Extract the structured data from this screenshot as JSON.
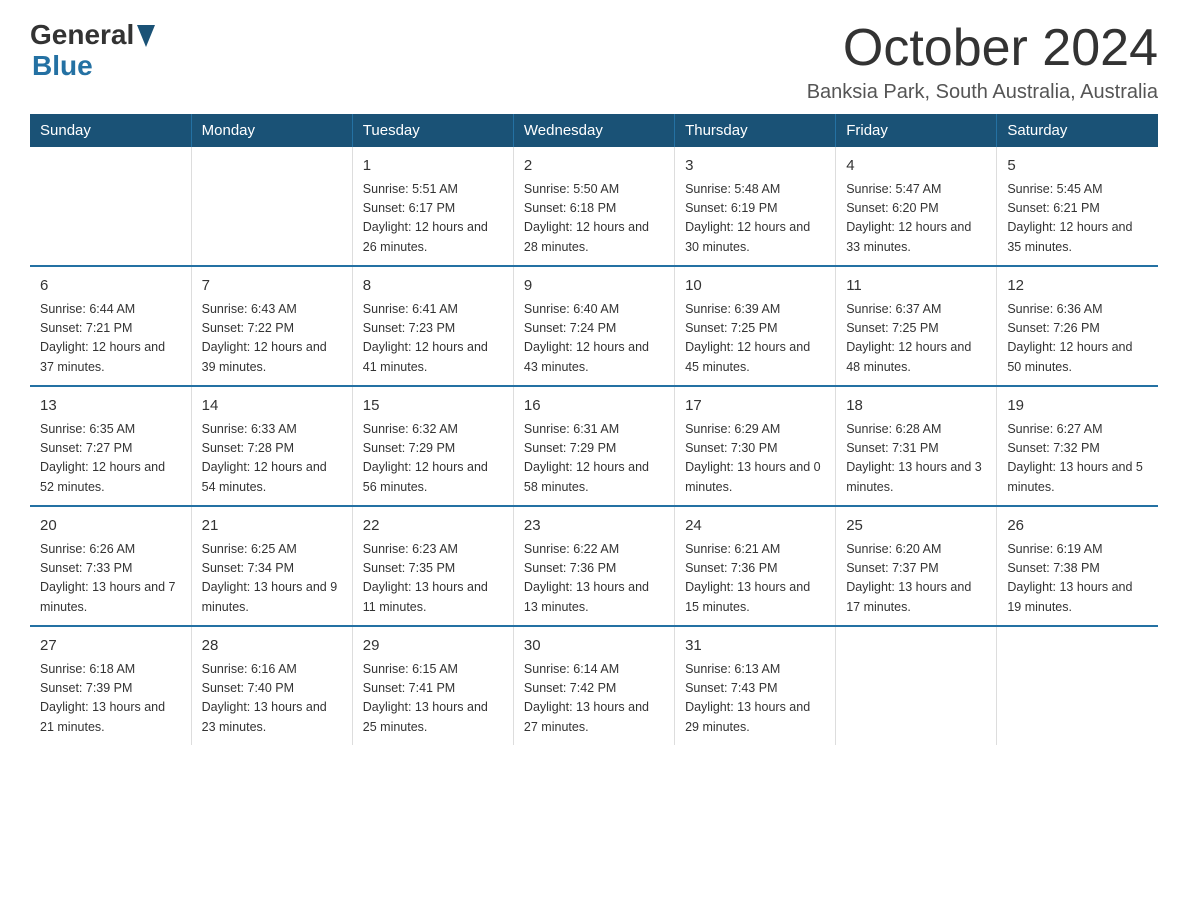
{
  "logo": {
    "text_general": "General",
    "text_blue": "Blue"
  },
  "header": {
    "month_year": "October 2024",
    "location": "Banksia Park, South Australia, Australia"
  },
  "weekdays": [
    "Sunday",
    "Monday",
    "Tuesday",
    "Wednesday",
    "Thursday",
    "Friday",
    "Saturday"
  ],
  "weeks": [
    [
      {
        "day": "",
        "sunrise": "",
        "sunset": "",
        "daylight": ""
      },
      {
        "day": "",
        "sunrise": "",
        "sunset": "",
        "daylight": ""
      },
      {
        "day": "1",
        "sunrise": "Sunrise: 5:51 AM",
        "sunset": "Sunset: 6:17 PM",
        "daylight": "Daylight: 12 hours and 26 minutes."
      },
      {
        "day": "2",
        "sunrise": "Sunrise: 5:50 AM",
        "sunset": "Sunset: 6:18 PM",
        "daylight": "Daylight: 12 hours and 28 minutes."
      },
      {
        "day": "3",
        "sunrise": "Sunrise: 5:48 AM",
        "sunset": "Sunset: 6:19 PM",
        "daylight": "Daylight: 12 hours and 30 minutes."
      },
      {
        "day": "4",
        "sunrise": "Sunrise: 5:47 AM",
        "sunset": "Sunset: 6:20 PM",
        "daylight": "Daylight: 12 hours and 33 minutes."
      },
      {
        "day": "5",
        "sunrise": "Sunrise: 5:45 AM",
        "sunset": "Sunset: 6:21 PM",
        "daylight": "Daylight: 12 hours and 35 minutes."
      }
    ],
    [
      {
        "day": "6",
        "sunrise": "Sunrise: 6:44 AM",
        "sunset": "Sunset: 7:21 PM",
        "daylight": "Daylight: 12 hours and 37 minutes."
      },
      {
        "day": "7",
        "sunrise": "Sunrise: 6:43 AM",
        "sunset": "Sunset: 7:22 PM",
        "daylight": "Daylight: 12 hours and 39 minutes."
      },
      {
        "day": "8",
        "sunrise": "Sunrise: 6:41 AM",
        "sunset": "Sunset: 7:23 PM",
        "daylight": "Daylight: 12 hours and 41 minutes."
      },
      {
        "day": "9",
        "sunrise": "Sunrise: 6:40 AM",
        "sunset": "Sunset: 7:24 PM",
        "daylight": "Daylight: 12 hours and 43 minutes."
      },
      {
        "day": "10",
        "sunrise": "Sunrise: 6:39 AM",
        "sunset": "Sunset: 7:25 PM",
        "daylight": "Daylight: 12 hours and 45 minutes."
      },
      {
        "day": "11",
        "sunrise": "Sunrise: 6:37 AM",
        "sunset": "Sunset: 7:25 PM",
        "daylight": "Daylight: 12 hours and 48 minutes."
      },
      {
        "day": "12",
        "sunrise": "Sunrise: 6:36 AM",
        "sunset": "Sunset: 7:26 PM",
        "daylight": "Daylight: 12 hours and 50 minutes."
      }
    ],
    [
      {
        "day": "13",
        "sunrise": "Sunrise: 6:35 AM",
        "sunset": "Sunset: 7:27 PM",
        "daylight": "Daylight: 12 hours and 52 minutes."
      },
      {
        "day": "14",
        "sunrise": "Sunrise: 6:33 AM",
        "sunset": "Sunset: 7:28 PM",
        "daylight": "Daylight: 12 hours and 54 minutes."
      },
      {
        "day": "15",
        "sunrise": "Sunrise: 6:32 AM",
        "sunset": "Sunset: 7:29 PM",
        "daylight": "Daylight: 12 hours and 56 minutes."
      },
      {
        "day": "16",
        "sunrise": "Sunrise: 6:31 AM",
        "sunset": "Sunset: 7:29 PM",
        "daylight": "Daylight: 12 hours and 58 minutes."
      },
      {
        "day": "17",
        "sunrise": "Sunrise: 6:29 AM",
        "sunset": "Sunset: 7:30 PM",
        "daylight": "Daylight: 13 hours and 0 minutes."
      },
      {
        "day": "18",
        "sunrise": "Sunrise: 6:28 AM",
        "sunset": "Sunset: 7:31 PM",
        "daylight": "Daylight: 13 hours and 3 minutes."
      },
      {
        "day": "19",
        "sunrise": "Sunrise: 6:27 AM",
        "sunset": "Sunset: 7:32 PM",
        "daylight": "Daylight: 13 hours and 5 minutes."
      }
    ],
    [
      {
        "day": "20",
        "sunrise": "Sunrise: 6:26 AM",
        "sunset": "Sunset: 7:33 PM",
        "daylight": "Daylight: 13 hours and 7 minutes."
      },
      {
        "day": "21",
        "sunrise": "Sunrise: 6:25 AM",
        "sunset": "Sunset: 7:34 PM",
        "daylight": "Daylight: 13 hours and 9 minutes."
      },
      {
        "day": "22",
        "sunrise": "Sunrise: 6:23 AM",
        "sunset": "Sunset: 7:35 PM",
        "daylight": "Daylight: 13 hours and 11 minutes."
      },
      {
        "day": "23",
        "sunrise": "Sunrise: 6:22 AM",
        "sunset": "Sunset: 7:36 PM",
        "daylight": "Daylight: 13 hours and 13 minutes."
      },
      {
        "day": "24",
        "sunrise": "Sunrise: 6:21 AM",
        "sunset": "Sunset: 7:36 PM",
        "daylight": "Daylight: 13 hours and 15 minutes."
      },
      {
        "day": "25",
        "sunrise": "Sunrise: 6:20 AM",
        "sunset": "Sunset: 7:37 PM",
        "daylight": "Daylight: 13 hours and 17 minutes."
      },
      {
        "day": "26",
        "sunrise": "Sunrise: 6:19 AM",
        "sunset": "Sunset: 7:38 PM",
        "daylight": "Daylight: 13 hours and 19 minutes."
      }
    ],
    [
      {
        "day": "27",
        "sunrise": "Sunrise: 6:18 AM",
        "sunset": "Sunset: 7:39 PM",
        "daylight": "Daylight: 13 hours and 21 minutes."
      },
      {
        "day": "28",
        "sunrise": "Sunrise: 6:16 AM",
        "sunset": "Sunset: 7:40 PM",
        "daylight": "Daylight: 13 hours and 23 minutes."
      },
      {
        "day": "29",
        "sunrise": "Sunrise: 6:15 AM",
        "sunset": "Sunset: 7:41 PM",
        "daylight": "Daylight: 13 hours and 25 minutes."
      },
      {
        "day": "30",
        "sunrise": "Sunrise: 6:14 AM",
        "sunset": "Sunset: 7:42 PM",
        "daylight": "Daylight: 13 hours and 27 minutes."
      },
      {
        "day": "31",
        "sunrise": "Sunrise: 6:13 AM",
        "sunset": "Sunset: 7:43 PM",
        "daylight": "Daylight: 13 hours and 29 minutes."
      },
      {
        "day": "",
        "sunrise": "",
        "sunset": "",
        "daylight": ""
      },
      {
        "day": "",
        "sunrise": "",
        "sunset": "",
        "daylight": ""
      }
    ]
  ]
}
